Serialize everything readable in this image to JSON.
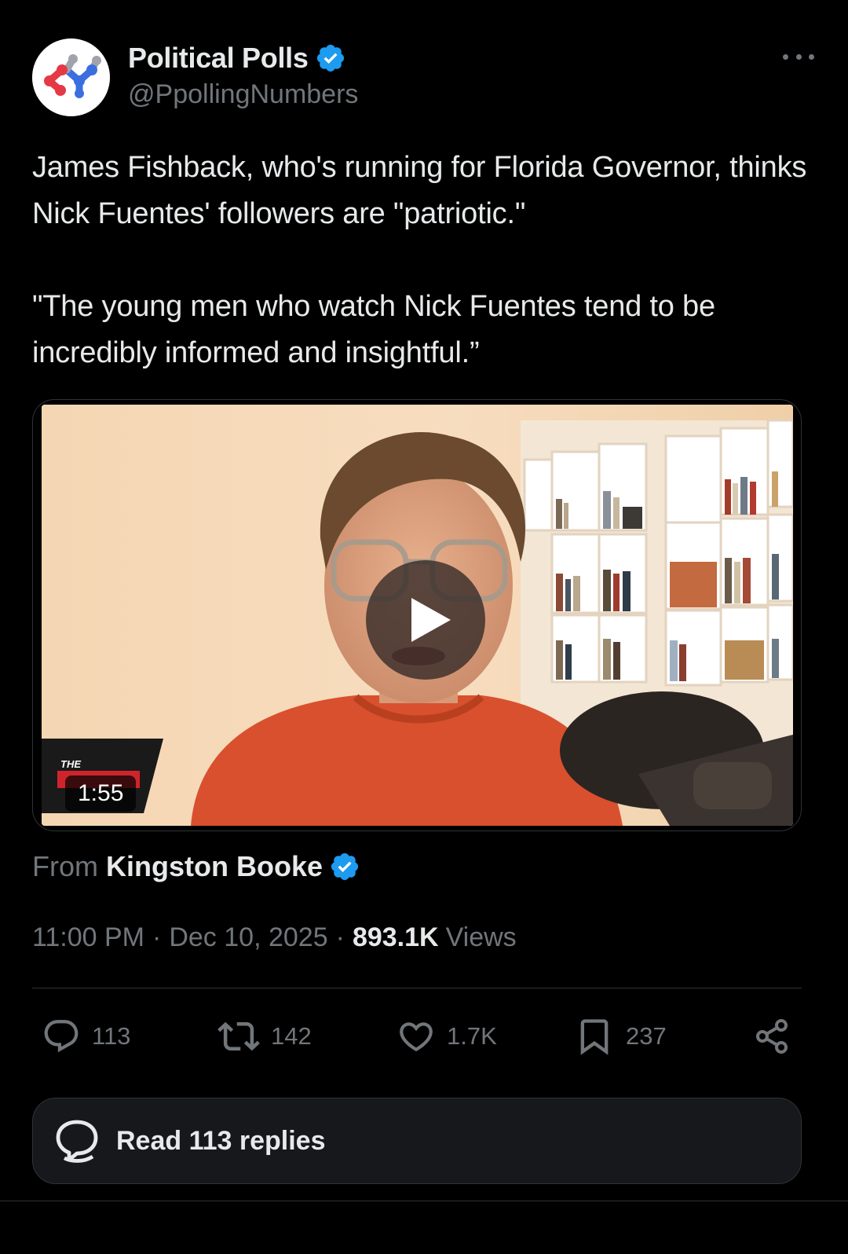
{
  "author": {
    "display_name": "Political Polls",
    "handle": "@PpollingNumbers",
    "verified": true,
    "avatar_icon": "political-polls-logo"
  },
  "tweet": {
    "paragraphs": [
      "James Fishback, who's running for Florida Governor, thinks Nick Fuentes' followers are \"patriotic.\"",
      "\"The young men who watch Nick Fuentes tend to be incredibly informed and insightful.”"
    ]
  },
  "media": {
    "duration": "1:55",
    "overlay_logo_text": "THE"
  },
  "source": {
    "prefix": "From",
    "name": "Kingston Booke",
    "verified": true
  },
  "meta": {
    "time": "11:00 PM",
    "separator": "·",
    "date": "Dec 10, 2025",
    "views_count": "893.1K",
    "views_label": "Views"
  },
  "actions": {
    "replies": "113",
    "reposts": "142",
    "likes": "1.7K",
    "bookmarks": "237"
  },
  "read_replies": {
    "label": "Read 113 replies"
  },
  "colors": {
    "background": "#000000",
    "text": "#e7e9ea",
    "muted": "#71767b",
    "verified_blue": "#1d9bf0",
    "border": "#2f3336"
  }
}
